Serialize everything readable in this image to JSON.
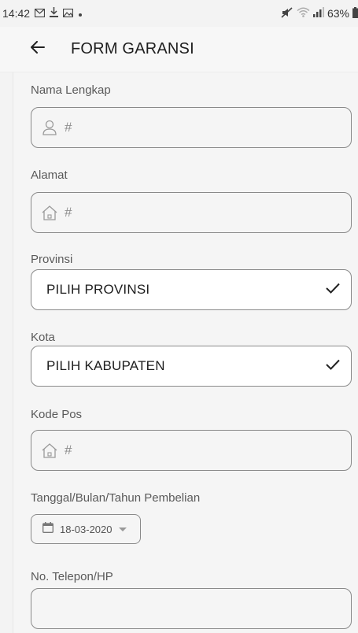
{
  "status_bar": {
    "time": "14:42",
    "battery": "63%",
    "icons": [
      "mail-icon",
      "download-icon",
      "image-icon",
      "dot-icon",
      "mute-icon",
      "wifi-icon",
      "signal-icon",
      "battery-icon"
    ]
  },
  "app_bar": {
    "back_icon": "arrow-left-icon",
    "title": "FORM GARANSI"
  },
  "form": {
    "nama": {
      "label": "Nama Lengkap",
      "value": "#",
      "icon": "person-icon"
    },
    "alamat": {
      "label": "Alamat",
      "value": "#",
      "icon": "house-icon"
    },
    "provinsi": {
      "label": "Provinsi",
      "value": "PILIH PROVINSI",
      "icon": "checkmark-icon"
    },
    "kota": {
      "label": "Kota",
      "value": "PILIH KABUPATEN",
      "icon": "checkmark-icon"
    },
    "kodepos": {
      "label": "Kode Pos",
      "value": "#",
      "icon": "house-icon"
    },
    "tanggal": {
      "label": "Tanggal/Bulan/Tahun Pembelian",
      "value": "18-03-2020",
      "icon": "calendar-icon"
    },
    "telepon": {
      "label": "No. Telepon/HP",
      "value": ""
    }
  },
  "colors": {
    "background": "#f3f3f3",
    "border": "#8a8a8a",
    "label": "#5a5a5a",
    "placeholder": "#8d8d8d"
  }
}
